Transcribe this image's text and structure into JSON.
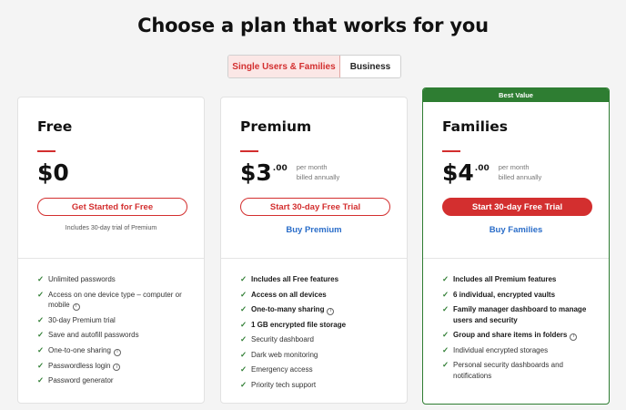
{
  "page": {
    "title": "Choose a plan that works for you"
  },
  "toggle": {
    "option_a": "Single Users & Families",
    "option_b": "Business",
    "selected": "option_a"
  },
  "plans": [
    {
      "name": "Free",
      "price_dollars": "$0",
      "price_cents": "",
      "per_line1": "",
      "per_line2": "",
      "cta": "Get Started for Free",
      "note": "Includes 30-day trial of Premium",
      "features": [
        {
          "text": "Unlimited passwords",
          "bold": false,
          "info": false
        },
        {
          "text": "Access on one device type – computer or mobile",
          "bold": false,
          "info": true
        },
        {
          "text": "30-day Premium trial",
          "bold": false,
          "info": false
        },
        {
          "text": "Save and autofill passwords",
          "bold": false,
          "info": false
        },
        {
          "text": "One-to-one sharing",
          "bold": false,
          "info": true
        },
        {
          "text": "Passwordless login",
          "bold": false,
          "info": true
        },
        {
          "text": "Password generator",
          "bold": false,
          "info": false
        }
      ]
    },
    {
      "name": "Premium",
      "price_dollars": "$3",
      "price_cents": ".00",
      "per_line1": "per month",
      "per_line2": "billed annually",
      "cta": "Start 30-day Free Trial",
      "buy_link": "Buy Premium",
      "features": [
        {
          "text": "Includes all Free features",
          "bold": true,
          "info": false
        },
        {
          "text": "Access on all devices",
          "bold": true,
          "info": false
        },
        {
          "text": "One-to-many sharing",
          "bold": true,
          "info": true
        },
        {
          "text": "1 GB encrypted file storage",
          "bold": true,
          "info": false
        },
        {
          "text": "Security dashboard",
          "bold": false,
          "info": false
        },
        {
          "text": "Dark web monitoring",
          "bold": false,
          "info": false
        },
        {
          "text": "Emergency access",
          "bold": false,
          "info": false
        },
        {
          "text": "Priority tech support",
          "bold": false,
          "info": false
        }
      ]
    },
    {
      "name": "Families",
      "badge": "Best Value",
      "price_dollars": "$4",
      "price_cents": ".00",
      "per_line1": "per month",
      "per_line2": "billed annually",
      "cta": "Start 30-day Free Trial",
      "buy_link": "Buy Families",
      "features": [
        {
          "text": "Includes all Premium features",
          "bold": true,
          "info": false
        },
        {
          "text": "6 individual, encrypted vaults",
          "bold": true,
          "info": false
        },
        {
          "text": "Family manager dashboard to manage users and security",
          "bold": true,
          "info": false
        },
        {
          "text": "Group and share items in folders",
          "bold": true,
          "info": true
        },
        {
          "text": "Individual encrypted storages",
          "bold": false,
          "info": false
        },
        {
          "text": "Personal security dashboards and notifications",
          "bold": false,
          "info": false
        }
      ]
    }
  ],
  "colors": {
    "accent": "#d32f2f",
    "best_value": "#2e7d32",
    "link": "#2a6dc9",
    "check": "#2e7d32"
  },
  "icons": {
    "check": "check-icon",
    "info": "info-icon"
  }
}
